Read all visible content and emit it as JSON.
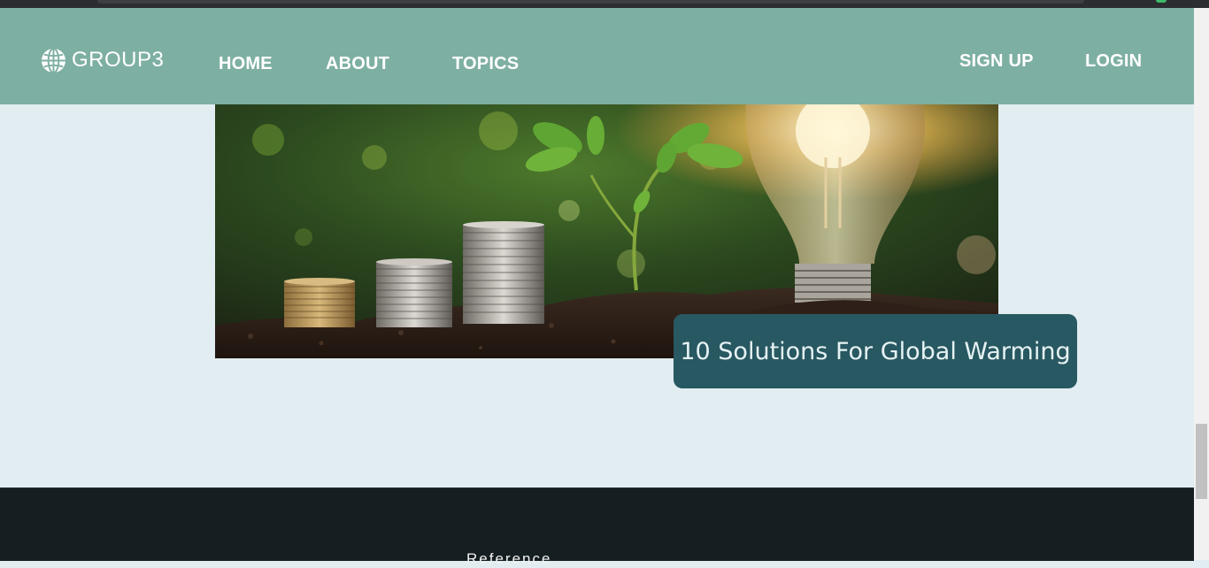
{
  "navbar": {
    "brand": "GROUP3",
    "brand_icon": "globe-icon",
    "links": [
      "HOME",
      "ABOUT",
      "TOPICS"
    ],
    "signup": "SIGN UP",
    "login": "LOGIN",
    "background": "#7eafa3"
  },
  "article": {
    "image": "coins-sprout-lightbulb",
    "title": "10 Solutions For Global Warming",
    "title_background": "#285861"
  },
  "footer": {
    "heading": "Reference",
    "background": "#151e21"
  }
}
